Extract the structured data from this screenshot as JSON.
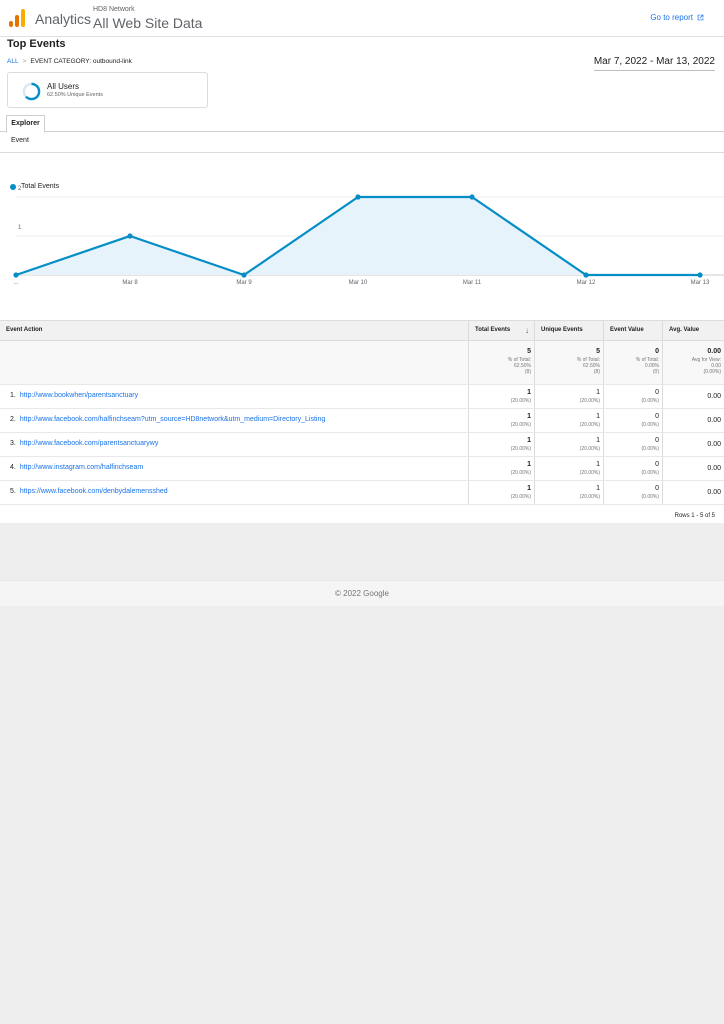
{
  "header": {
    "brand": "Analytics",
    "account": "HD8 Network",
    "property": "All Web Site Data",
    "goto_label": "Go to report"
  },
  "page": {
    "title": "Top Events",
    "breadcrumb_all": "ALL",
    "breadcrumb_sep": ">",
    "breadcrumb_current": "EVENT CATEGORY: outbound-link",
    "date_range": "Mar 7, 2022 - Mar 13, 2022"
  },
  "segment": {
    "name": "All Users",
    "sub": "62.50% Unique Events",
    "fraction": 0.625
  },
  "tabs": {
    "explorer": "Explorer",
    "event": "Event"
  },
  "chart_data": {
    "type": "line",
    "series": [
      {
        "name": "Total Events",
        "values": [
          0,
          1,
          0,
          2,
          2,
          0,
          0
        ]
      }
    ],
    "x": [
      "...",
      "Mar 8",
      "Mar 9",
      "Mar 10",
      "Mar 11",
      "Mar 12",
      "Mar 13"
    ],
    "yticks": [
      "1",
      "2"
    ],
    "ylim": [
      0,
      2
    ],
    "grid": true,
    "color": "#058dc7"
  },
  "table": {
    "columns": [
      "Event Action",
      "Total Events",
      "Unique Events",
      "Event Value",
      "Avg. Value"
    ],
    "totals": [
      {
        "value": "5",
        "sub": [
          "% of Total:",
          "62.50%",
          "(8)"
        ]
      },
      {
        "value": "5",
        "sub": [
          "% of Total:",
          "62.50%",
          "(8)"
        ]
      },
      {
        "value": "0",
        "sub": [
          "% of Total:",
          "0.00%",
          "(0)"
        ]
      },
      {
        "value": "0.00",
        "sub": [
          "Avg for View:",
          "0.00",
          "(0.00%)"
        ]
      }
    ],
    "rows": [
      {
        "index": "1.",
        "action": "http://www.bookwhen/parentsanctuary",
        "total": "1",
        "total_pct": "(20.00%)",
        "unique": "1",
        "unique_pct": "(20.00%)",
        "value": "0",
        "value_pct": "(0.00%)",
        "avg": "0.00"
      },
      {
        "index": "2.",
        "action": "http://www.facebook.com/halfinchseam?utm_source=HD8network&utm_medium=Directory_Listing",
        "total": "1",
        "total_pct": "(20.00%)",
        "unique": "1",
        "unique_pct": "(20.00%)",
        "value": "0",
        "value_pct": "(0.00%)",
        "avg": "0.00"
      },
      {
        "index": "3.",
        "action": "http://www.facebook.com/parentsanctuarywy",
        "total": "1",
        "total_pct": "(20.00%)",
        "unique": "1",
        "unique_pct": "(20.00%)",
        "value": "0",
        "value_pct": "(0.00%)",
        "avg": "0.00"
      },
      {
        "index": "4.",
        "action": "http://www.instagram.com/halfinchseam",
        "total": "1",
        "total_pct": "(20.00%)",
        "unique": "1",
        "unique_pct": "(20.00%)",
        "value": "0",
        "value_pct": "(0.00%)",
        "avg": "0.00"
      },
      {
        "index": "5.",
        "action": "https://www.facebook.com/denbydalemensshed",
        "total": "1",
        "total_pct": "(20.00%)",
        "unique": "1",
        "unique_pct": "(20.00%)",
        "value": "0",
        "value_pct": "(0.00%)",
        "avg": "0.00"
      }
    ],
    "rows_label": "Rows 1 - 5 of 5"
  },
  "footer": {
    "copyright": "© 2022 Google"
  },
  "icons": {
    "logo": "analytics-logo",
    "external": "external-link-icon",
    "sort": "sort-down-icon"
  }
}
